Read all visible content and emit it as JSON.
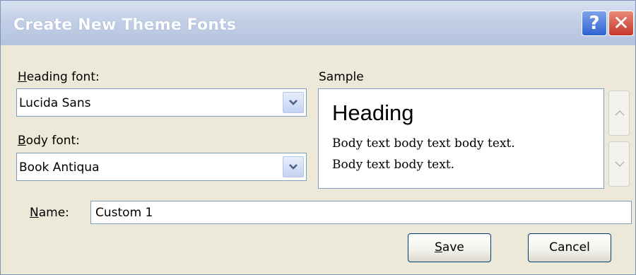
{
  "window": {
    "title": "Create New Theme Fonts"
  },
  "titlebar": {
    "help_label": "?",
    "close_label": "✕"
  },
  "heading_font": {
    "label": "Heading font:",
    "label_underline": "H",
    "label_rest": "eading font:",
    "value": "Lucida Sans"
  },
  "body_font": {
    "label": "Body font:",
    "label_underline": "B",
    "label_rest": "ody font:",
    "value": "Book Antiqua"
  },
  "sample": {
    "label": "Sample",
    "heading_text": "Heading",
    "body_line_1": "Body text body text body text.",
    "body_line_2": "Body text body text."
  },
  "name": {
    "label": "Name:",
    "label_underline": "N",
    "label_rest": "ame:",
    "value": "Custom 1"
  },
  "buttons": {
    "save": {
      "label": "Save",
      "underline": "S",
      "rest": "ave"
    },
    "cancel": {
      "label": "Cancel"
    }
  },
  "icons": {
    "dropdown": "chevron-down-icon",
    "scroll_up": "chevron-up-icon",
    "scroll_down": "chevron-down-icon",
    "help": "question-icon",
    "close": "close-icon"
  },
  "colors": {
    "title_text": "#ffffff",
    "dialog_bg": "#ECE9D8",
    "border": "#7f9db9",
    "help_button": "#2f62d4",
    "close_button": "#c6372a"
  }
}
